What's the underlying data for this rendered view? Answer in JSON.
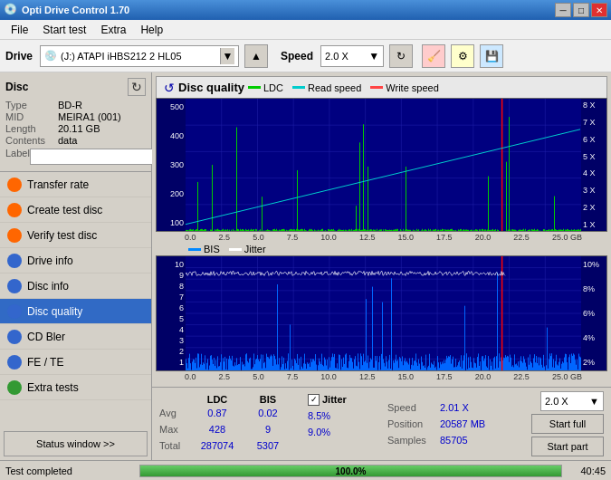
{
  "app": {
    "title": "Opti Drive Control 1.70"
  },
  "titlebar": {
    "title": "Opti Drive Control 1.70",
    "min_label": "─",
    "max_label": "□",
    "close_label": "✕"
  },
  "menubar": {
    "items": [
      "File",
      "Start test",
      "Extra",
      "Help"
    ]
  },
  "toolbar": {
    "drive_label": "Drive",
    "drive_value": "(J:)  ATAPI iHBS212  2 HL05",
    "speed_label": "Speed",
    "speed_value": "2.0 X"
  },
  "sidebar": {
    "disc_label": "Disc",
    "disc_type_label": "Type",
    "disc_type_value": "BD-R",
    "disc_mid_label": "MID",
    "disc_mid_value": "MEIRA1 (001)",
    "disc_length_label": "Length",
    "disc_length_value": "20.11 GB",
    "disc_contents_label": "Contents",
    "disc_contents_value": "data",
    "disc_label_label": "Label",
    "disc_label_value": "",
    "items": [
      {
        "id": "transfer-rate",
        "label": "Transfer rate",
        "icon_type": "orange"
      },
      {
        "id": "create-test-disc",
        "label": "Create test disc",
        "icon_type": "orange"
      },
      {
        "id": "verify-test-disc",
        "label": "Verify test disc",
        "icon_type": "orange"
      },
      {
        "id": "drive-info",
        "label": "Drive info",
        "icon_type": "blue"
      },
      {
        "id": "disc-info",
        "label": "Disc info",
        "icon_type": "blue"
      },
      {
        "id": "disc-quality",
        "label": "Disc quality",
        "icon_type": "blue",
        "active": true
      },
      {
        "id": "cd-bler",
        "label": "CD Bler",
        "icon_type": "blue"
      },
      {
        "id": "fe-te",
        "label": "FE / TE",
        "icon_type": "blue"
      },
      {
        "id": "extra-tests",
        "label": "Extra tests",
        "icon_type": "green"
      }
    ],
    "status_window_btn": "Status window >>"
  },
  "quality_panel": {
    "title": "Disc quality",
    "legend": [
      {
        "label": "LDC",
        "color": "#00cc00"
      },
      {
        "label": "Read speed",
        "color": "#00cccc"
      },
      {
        "label": "Write speed",
        "color": "#ff4444"
      }
    ],
    "legend2": [
      {
        "label": "BIS",
        "color": "#0088ff"
      },
      {
        "label": "Jitter",
        "color": "#ffffff"
      }
    ]
  },
  "stats": {
    "ldc_header": "LDC",
    "bis_header": "BIS",
    "jitter_header": "Jitter",
    "speed_header": "Speed",
    "position_header": "Position",
    "samples_header": "Samples",
    "rows": [
      {
        "label": "Avg",
        "ldc": "0.87",
        "bis": "0.02",
        "jitter": "8.5%",
        "speed": "2.01 X",
        "position": "20587 MB"
      },
      {
        "label": "Max",
        "ldc": "428",
        "bis": "9",
        "jitter": "9.0%",
        "samples": "85705"
      },
      {
        "label": "Total",
        "ldc": "287074",
        "bis": "5307"
      }
    ],
    "speed_select": "2.0 X",
    "btn_start_full": "Start full",
    "btn_start_part": "Start part"
  },
  "statusbar": {
    "status_text": "Test completed",
    "progress_pct": 100,
    "progress_label": "100.0%",
    "time_label": "40:45"
  },
  "chart1": {
    "y_axis": [
      "500",
      "400",
      "300",
      "200",
      "100"
    ],
    "y_axis_right": [
      "8 X",
      "7 X",
      "6 X",
      "5 X",
      "4 X",
      "3 X",
      "2 X",
      "1 X"
    ],
    "x_axis": [
      "0.0",
      "2.5",
      "5.0",
      "7.5",
      "10.0",
      "12.5",
      "15.0",
      "17.5",
      "20.0",
      "22.5",
      "25.0 GB"
    ]
  },
  "chart2": {
    "y_axis": [
      "10",
      "9",
      "8",
      "7",
      "6",
      "5",
      "4",
      "3",
      "2",
      "1"
    ],
    "y_axis_right": [
      "10%",
      "8%",
      "6%",
      "4%",
      "2%"
    ],
    "x_axis": [
      "0.0",
      "2.5",
      "5.0",
      "7.5",
      "10.0",
      "12.5",
      "15.0",
      "17.5",
      "20.0",
      "22.5",
      "25.0 GB"
    ]
  }
}
